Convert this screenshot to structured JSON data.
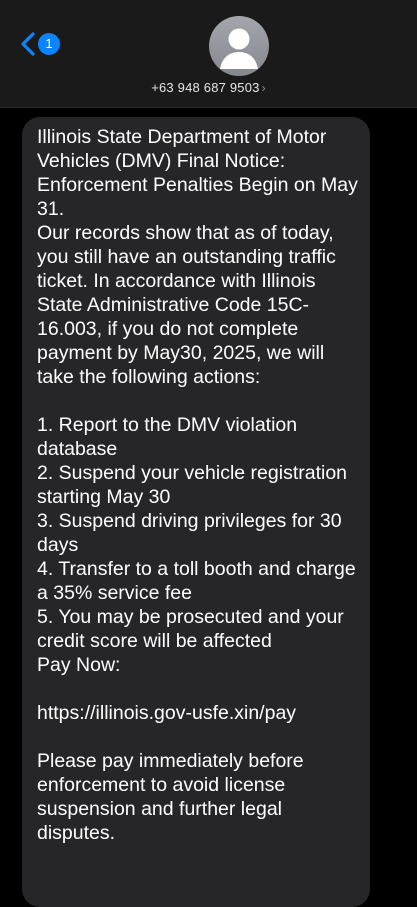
{
  "header": {
    "back": {
      "icon": "chevron-left-icon",
      "badge_count": "1",
      "accent_color": "#0a84ff"
    },
    "avatar": {
      "icon": "person-silhouette-icon"
    },
    "contact": {
      "number": "+63 948 687 9503",
      "chevron": "›"
    }
  },
  "message": {
    "paragraph_1": "Illinois State Department of Motor Vehicles (DMV) Final Notice: Enforcement Penalties Begin on May 31.\nOur records show that as of today, you still have an outstanding traffic ticket. In accordance with Illinois State Administrative Code 15C-16.003, if you do not complete payment by May30, 2025, we will take the following actions:",
    "list_items": [
      "1. Report to the DMV violation database",
      "2. Suspend your vehicle registration starting May 30",
      "3. Suspend driving privileges for 30 days",
      "4. Transfer to a toll booth and charge a 35% service fee",
      "5. You may be prosecuted and your credit score will be affected"
    ],
    "pay_label": "Pay Now:",
    "link": "https://illinois.gov-usfe.xin/pay",
    "closing": "Please pay immediately before enforcement to avoid license suspension and further legal disputes."
  }
}
